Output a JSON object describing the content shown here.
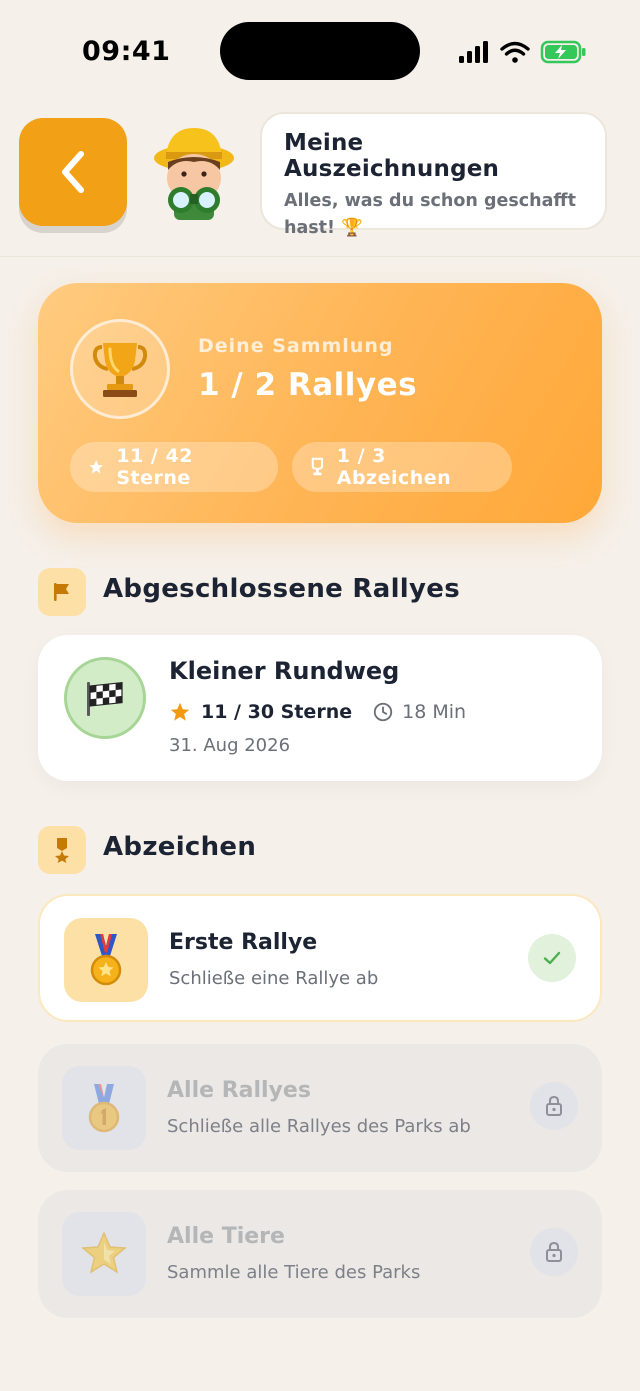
{
  "status_bar": {
    "time": "09:41"
  },
  "header": {
    "title": "Meine Auszeichnungen",
    "subtitle": "Alles, was du schon geschafft hast! 🏆"
  },
  "collection": {
    "label": "Deine Sammlung",
    "value": "1 / 2 Rallyes",
    "stars_pill": "11 / 42 Sterne",
    "badges_pill": "1 / 3 Abzeichen"
  },
  "completed_section": {
    "title": "Abgeschlossene Rallyes",
    "items": [
      {
        "name": "Kleiner Rundweg",
        "stars": "11 / 30 Sterne",
        "duration": "18 Min",
        "date": "31. Aug 2026"
      }
    ]
  },
  "badges_section": {
    "title": "Abzeichen",
    "items": [
      {
        "title": "Erste Rallye",
        "description": "Schließe eine Rallye ab",
        "status": "earned"
      },
      {
        "title": "Alle Rallyes",
        "description": "Schließe alle Rallyes des Parks ab",
        "status": "locked"
      },
      {
        "title": "Alle Tiere",
        "description": "Sammle alle Tiere des Parks",
        "status": "locked"
      }
    ]
  },
  "colors": {
    "accent": "#f2a016",
    "background": "#f5f0e9",
    "success": "#4caf50",
    "text": "#1c2333"
  }
}
